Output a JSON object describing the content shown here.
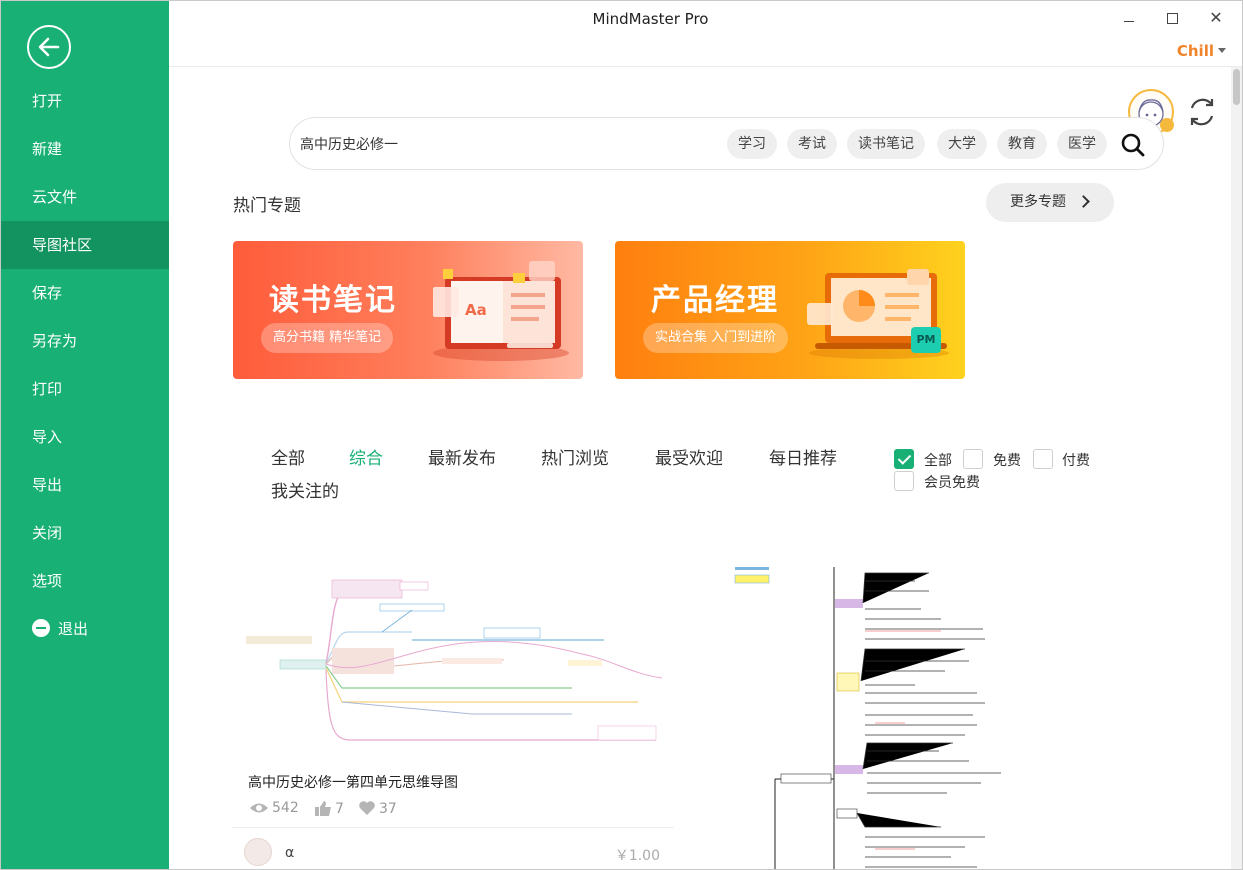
{
  "window": {
    "title": "MindMaster Pro",
    "close_glyph": "✕",
    "user": "Chill"
  },
  "sidebar": {
    "items": [
      {
        "label": "打开"
      },
      {
        "label": "新建"
      },
      {
        "label": "云文件"
      },
      {
        "label": "导图社区",
        "active": true
      },
      {
        "label": "保存"
      },
      {
        "label": "另存为"
      },
      {
        "label": "打印"
      },
      {
        "label": "导入"
      },
      {
        "label": "导出"
      },
      {
        "label": "关闭"
      },
      {
        "label": "选项"
      },
      {
        "label": "退出"
      }
    ]
  },
  "search": {
    "value": "高中历史必修一",
    "tags": [
      "学习",
      "考试",
      "读书笔记",
      "大学",
      "教育",
      "医学"
    ]
  },
  "hot_topics": {
    "title": "热门专题",
    "more_label": "更多专题",
    "banners": [
      {
        "title": "读书笔记",
        "subtitle": "高分书籍 精华笔记"
      },
      {
        "title": "产品经理",
        "subtitle": "实战合集 入门到进阶",
        "badge": "PM"
      }
    ]
  },
  "filters": {
    "tabs": [
      "全部",
      "综合",
      "最新发布",
      "热门浏览",
      "最受欢迎",
      "每日推荐",
      "我关注的"
    ],
    "active_tab": "综合",
    "price_options": [
      {
        "label": "全部",
        "checked": true
      },
      {
        "label": "免费",
        "checked": false
      },
      {
        "label": "付费",
        "checked": false
      },
      {
        "label": "会员免费",
        "checked": false
      }
    ]
  },
  "cards": [
    {
      "title": "高中历史必修一第四单元思维导图",
      "views": "542",
      "likes": "7",
      "favorites": "37",
      "author": "α",
      "price": "￥1.00"
    }
  ],
  "colors": {
    "brand_green": "#18b074",
    "sidebar_active": "#12935f",
    "user_orange": "#f0842b"
  }
}
